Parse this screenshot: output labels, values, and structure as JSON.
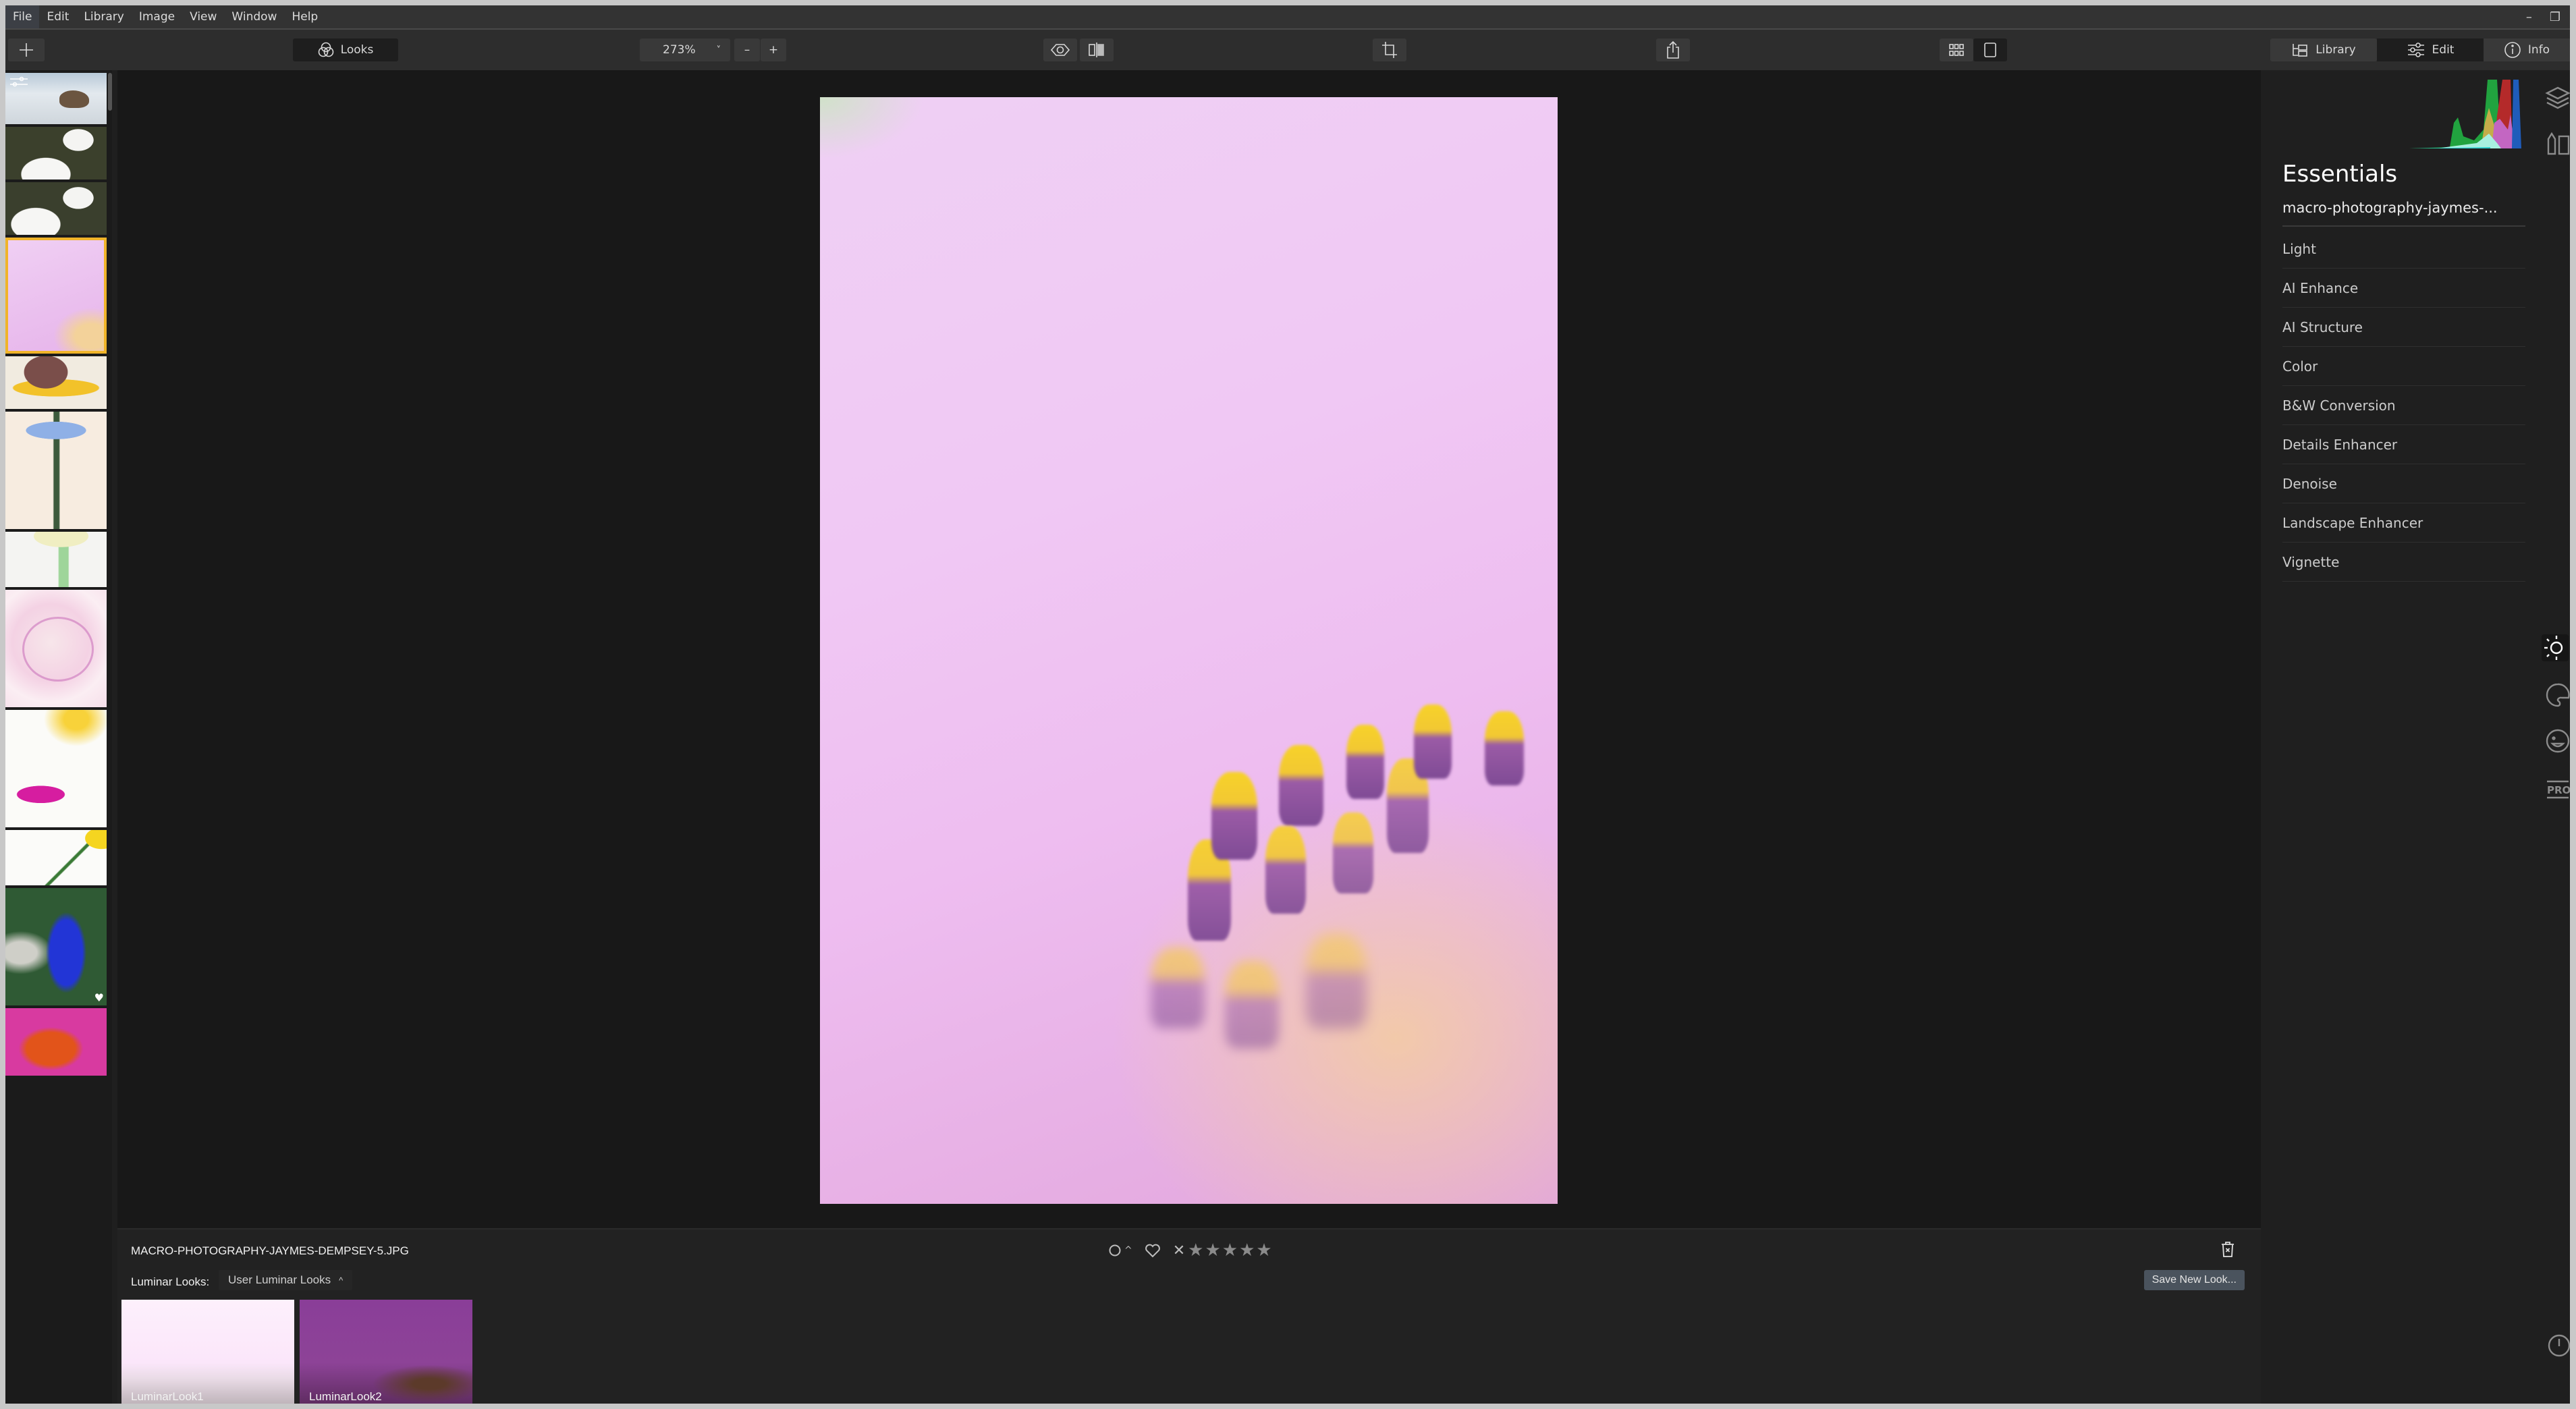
{
  "menu": {
    "items": [
      "File",
      "Edit",
      "Library",
      "Image",
      "View",
      "Window",
      "Help"
    ]
  },
  "window_controls": {
    "minimize": "–",
    "restore": "❐"
  },
  "toolbar": {
    "add_icon": "plus-icon",
    "looks_label": "Looks",
    "zoom_value": "273%",
    "zoom_caret": "˅",
    "zoom_out": "–",
    "zoom_in": "+",
    "library_label": "Library",
    "edit_label": "Edit",
    "info_label": "Info",
    "active_mode": "Edit"
  },
  "filmstrip": {
    "selected_index": 3,
    "thumbnails": [
      {
        "subject": "shorebird on water",
        "edited": true
      },
      {
        "subject": "white egret preening"
      },
      {
        "subject": "white egret preening 2"
      },
      {
        "subject": "pink cosmos macro"
      },
      {
        "subject": "yellow coneflower"
      },
      {
        "subject": "blue aster"
      },
      {
        "subject": "white tulip"
      },
      {
        "subject": "pink dahlia"
      },
      {
        "subject": "magenta daisy"
      },
      {
        "subject": "white daisy stem"
      },
      {
        "subject": "blue salvia",
        "favorite": true
      },
      {
        "subject": "orange-pink flower"
      }
    ]
  },
  "image": {
    "filename": "MACRO-PHOTOGRAPHY-JAYMES-DEMPSEY-5.JPG",
    "rating_stars": 0,
    "max_stars": 5,
    "star_glyph": "★",
    "flag_caret": "^",
    "reject_glyph": "✕"
  },
  "looks": {
    "label": "Luminar Looks:",
    "category": "User Luminar Looks",
    "category_caret": "^",
    "save_button": "Save New Look...",
    "items": [
      {
        "name": "LuminarLook1"
      },
      {
        "name": "LuminarLook2"
      }
    ]
  },
  "essentials": {
    "title": "Essentials",
    "filename": "macro-photography-jaymes-...",
    "tools": [
      "Light",
      "AI Enhance",
      "AI Structure",
      "Color",
      "B&W Conversion",
      "Details Enhancer",
      "Denoise",
      "Landscape Enhancer",
      "Vignette"
    ]
  },
  "side_icons": [
    "layers-icon",
    "brush-icon",
    "sun-icon",
    "palette-icon",
    "smile-icon",
    "pro-icon",
    "clock-icon"
  ],
  "colors": {
    "accent_selected": "#f0b429",
    "save_button_bg": "#4a535d"
  }
}
